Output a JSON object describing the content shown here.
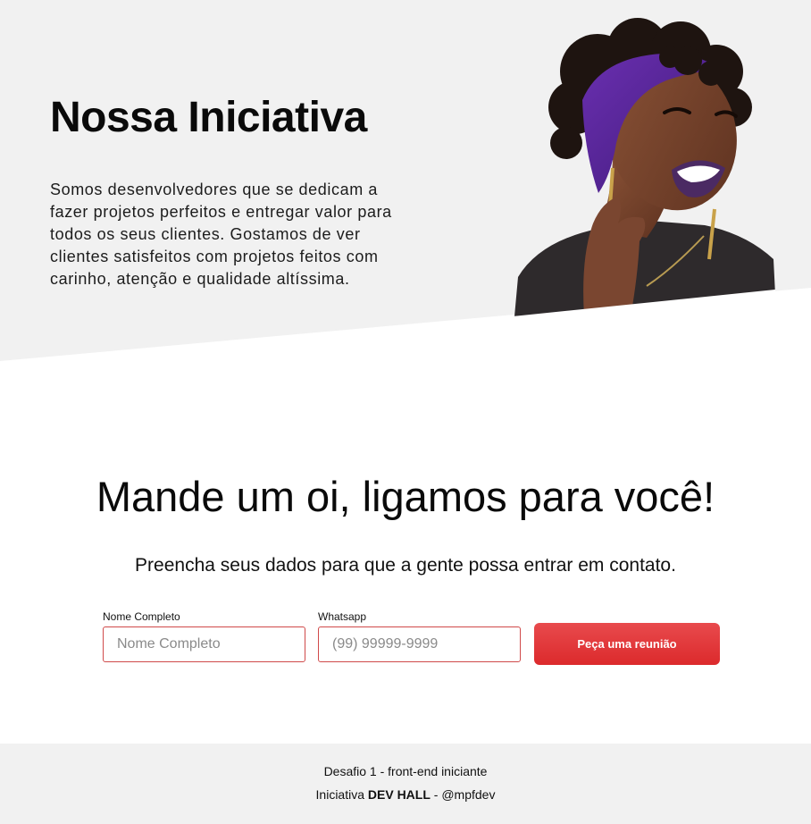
{
  "hero": {
    "title": "Nossa Iniciativa",
    "description": "Somos desenvolvedores que se dedicam a fazer projetos perfeitos e entregar valor para todos os seus clientes. Gostamos de ver clientes satisfeitos com projetos feitos com carinho, atenção e qualidade altíssima.",
    "background_color": "#f1f1f1"
  },
  "contact": {
    "title": "Mande um oi, ligamos para você!",
    "subtitle": "Preencha seus dados para que a gente possa entrar em contato.",
    "name_field": {
      "label": "Nome Completo",
      "placeholder": "Nome Completo",
      "value": ""
    },
    "phone_field": {
      "label": "Whatsapp",
      "placeholder": "(99) 99999-9999",
      "value": ""
    },
    "submit_label": "Peça uma reunião",
    "accent_color": "#e0393b"
  },
  "footer": {
    "line1": "Desafio 1 - front-end iniciante",
    "line2_prefix": "Iniciativa ",
    "line2_brand": "DEV HALL",
    "line2_suffix": " - @mpfdev"
  }
}
